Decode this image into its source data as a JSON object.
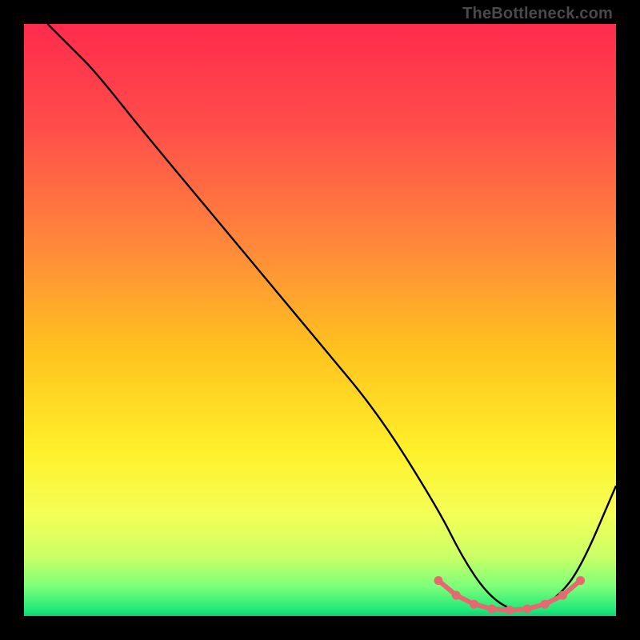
{
  "watermark": "TheBottleneck.com",
  "chart_data": {
    "type": "line",
    "title": "",
    "xlabel": "",
    "ylabel": "",
    "xlim": [
      0,
      100
    ],
    "ylim": [
      0,
      100
    ],
    "series": [
      {
        "name": "curve",
        "x": [
          4,
          8,
          12,
          20,
          30,
          40,
          50,
          60,
          70,
          74,
          78,
          82,
          86,
          90,
          94,
          100
        ],
        "y": [
          100,
          96,
          92,
          82,
          70,
          58,
          46,
          34,
          18,
          10,
          4,
          1,
          1,
          3,
          8,
          22
        ]
      }
    ],
    "highlight_segment": {
      "name": "dotted-pink-band",
      "x": [
        70,
        73,
        76,
        79,
        82,
        85,
        88,
        91,
        94
      ],
      "y": [
        6,
        3.5,
        2,
        1.2,
        1,
        1.2,
        2,
        3.5,
        6
      ]
    },
    "background_gradient": {
      "stops": [
        {
          "offset": 0.0,
          "color": "#ff2b4d"
        },
        {
          "offset": 0.18,
          "color": "#ff4f4a"
        },
        {
          "offset": 0.38,
          "color": "#ff8a3a"
        },
        {
          "offset": 0.55,
          "color": "#ffc21f"
        },
        {
          "offset": 0.72,
          "color": "#fff02a"
        },
        {
          "offset": 0.83,
          "color": "#f4ff57"
        },
        {
          "offset": 0.9,
          "color": "#c9ff66"
        },
        {
          "offset": 0.95,
          "color": "#7dff7a"
        },
        {
          "offset": 0.99,
          "color": "#20e87a"
        },
        {
          "offset": 1.0,
          "color": "#0fd173"
        }
      ]
    },
    "colors": {
      "curve": "#000000",
      "highlight": "#e46a6f"
    }
  }
}
